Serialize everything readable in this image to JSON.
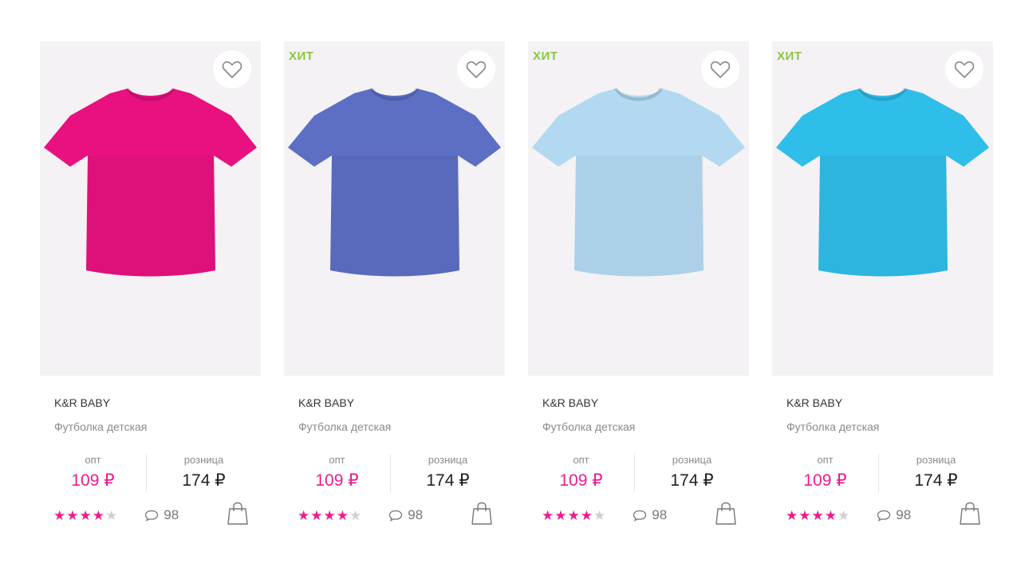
{
  "products": [
    {
      "badge": "",
      "color": "#e8117f",
      "brand": "K&R BABY",
      "name": "Футболка детская",
      "opt_label": "опт",
      "opt_price": "109 ₽",
      "retail_label": "розница",
      "retail_price": "174 ₽",
      "rating": 4,
      "comments": "98"
    },
    {
      "badge": "ХИТ",
      "color": "#5d6fc4",
      "brand": "K&R BABY",
      "name": "Футболка детская",
      "opt_label": "опт",
      "opt_price": "109 ₽",
      "retail_label": "розница",
      "retail_price": "174 ₽",
      "rating": 4,
      "comments": "98"
    },
    {
      "badge": "ХИТ",
      "color": "#b3d9f2",
      "brand": "K&R BABY",
      "name": "Футболка детская",
      "opt_label": "опт",
      "opt_price": "109 ₽",
      "retail_label": "розница",
      "retail_price": "174 ₽",
      "rating": 4,
      "comments": "98"
    },
    {
      "badge": "ХИТ",
      "color": "#2fbdea",
      "brand": "K&R BABY",
      "name": "Футболка детская",
      "opt_label": "опт",
      "opt_price": "109 ₽",
      "retail_label": "розница",
      "retail_price": "174 ₽",
      "rating": 4,
      "comments": "98"
    }
  ],
  "icons": {
    "favorite": "heart-icon",
    "comments": "speech-bubble-icon",
    "cart": "shopping-bag-icon",
    "rating": "star-icon"
  },
  "colors": {
    "accent": "#ec1c8f",
    "badge": "#8cc63f",
    "star_off": "#d0d0d0"
  }
}
